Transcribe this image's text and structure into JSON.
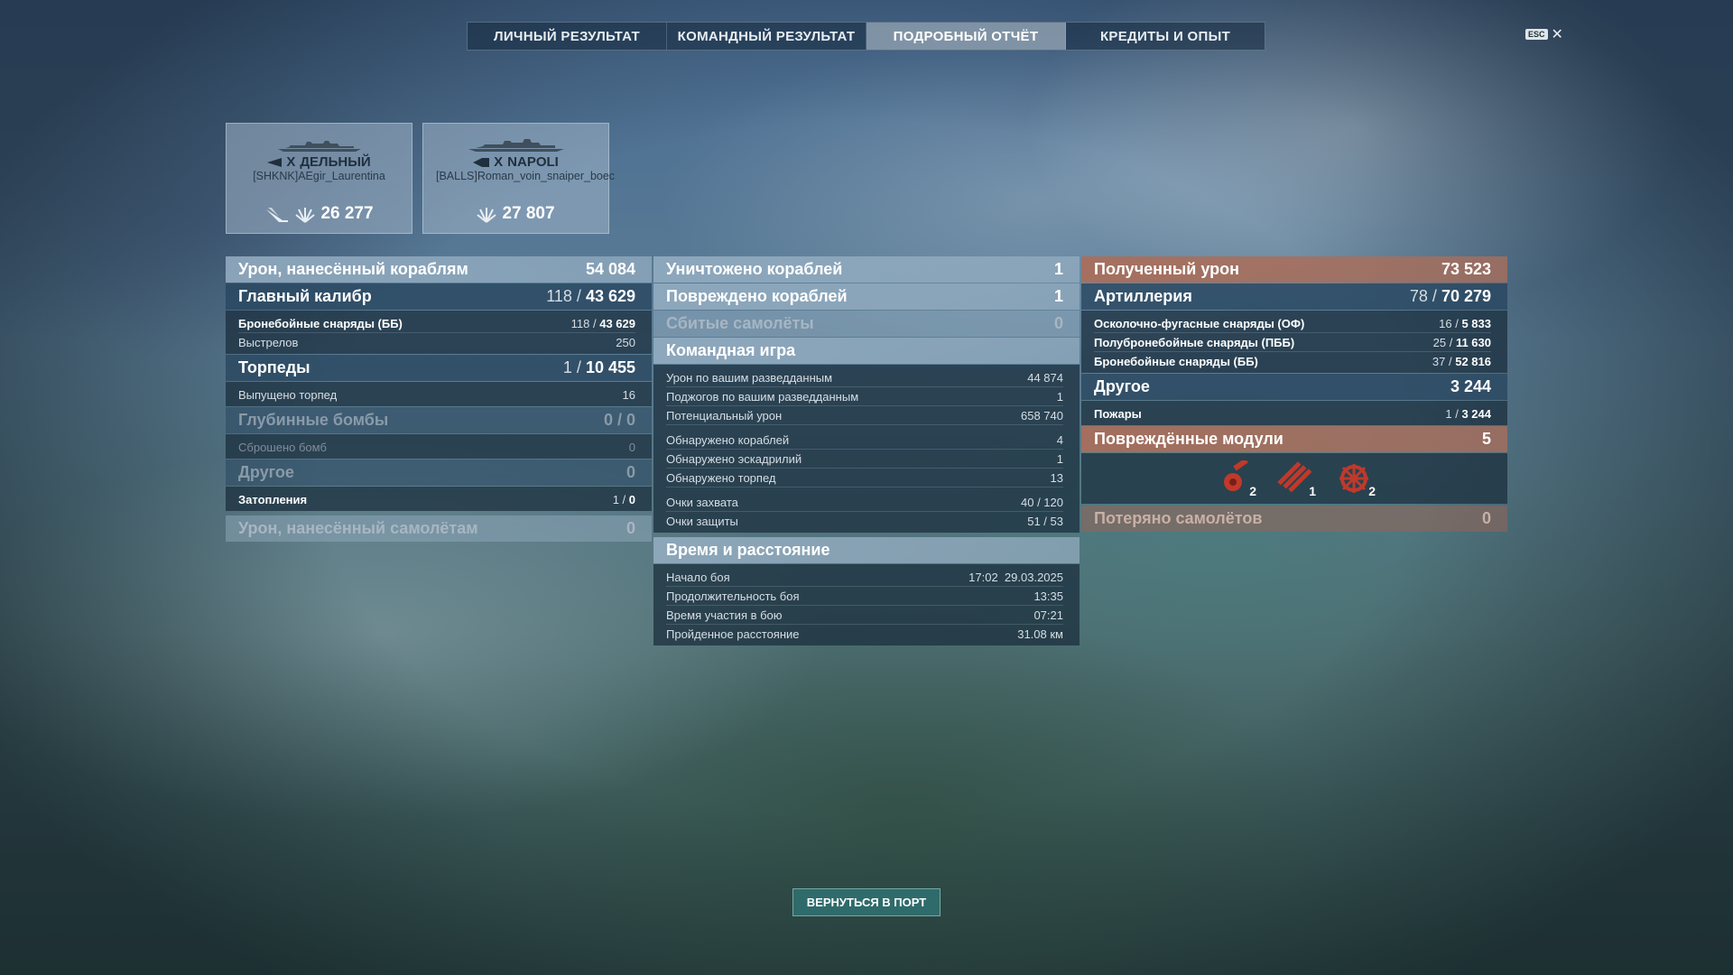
{
  "tabs": [
    {
      "label": "ЛИЧНЫЙ РЕЗУЛЬТАТ",
      "active": false
    },
    {
      "label": "КОМАНДНЫЙ РЕЗУЛЬТАТ",
      "active": false
    },
    {
      "label": "ПОДРОБНЫЙ ОТЧЁТ",
      "active": true
    },
    {
      "label": "КРЕДИТЫ И ОПЫТ",
      "active": false
    }
  ],
  "esc": {
    "key": "ESC",
    "close": "✕"
  },
  "ships": [
    {
      "tier": "X",
      "name": "ДЕЛЬНЫЙ",
      "player": "[SHKNK]AEgir_Laurentina",
      "damage": "26 277"
    },
    {
      "tier": "X",
      "name": "NAPOLI",
      "player": "[BALLS]Roman_voin_snaiper_boec",
      "damage": "27 807"
    }
  ],
  "damage_dealt": {
    "title": "Урон, нанесённый кораблям",
    "value": "54 084",
    "main_battery": {
      "title": "Главный калибр",
      "hits": "118",
      "damage": "43 629"
    },
    "ap_shells": {
      "label": "Бронебойные снаряды (ББ)",
      "hits": "118",
      "damage": "43 629"
    },
    "shots": {
      "label": "Выстрелов",
      "value": "250"
    },
    "torpedoes": {
      "title": "Торпеды",
      "hits": "1",
      "damage": "10 455"
    },
    "torpedoes_launched": {
      "label": "Выпущено торпед",
      "value": "16"
    },
    "depth_charges": {
      "title": "Глубинные бомбы",
      "hits": "0",
      "damage": "0"
    },
    "bombs_dropped": {
      "label": "Сброшено бомб",
      "value": "0"
    },
    "other": {
      "title": "Другое",
      "value": "0"
    },
    "flooding": {
      "label": "Затопления",
      "hits": "1",
      "damage": "0"
    },
    "aircraft_damage": {
      "title": "Урон, нанесённый самолётам",
      "value": "0"
    }
  },
  "results": {
    "destroyed": {
      "title": "Уничтожено кораблей",
      "value": "1"
    },
    "damaged": {
      "title": "Повреждено кораблей",
      "value": "1"
    },
    "planes_shot": {
      "title": "Сбитые самолёты",
      "value": "0"
    },
    "team_play": {
      "title": "Командная игра",
      "rows": [
        {
          "label": "Урон по вашим разведданным",
          "value": "44 874"
        },
        {
          "label": "Поджогов по вашим разведданным",
          "value": "1"
        },
        {
          "label": "Потенциальный урон",
          "value": "658 740"
        }
      ],
      "rows2": [
        {
          "label": "Обнаружено кораблей",
          "value": "4"
        },
        {
          "label": "Обнаружено эскадрилий",
          "value": "1"
        },
        {
          "label": "Обнаружено торпед",
          "value": "13"
        }
      ],
      "rows3": [
        {
          "label": "Очки захвата",
          "value": "40 / 120"
        },
        {
          "label": "Очки защиты",
          "value": "51 / 53"
        }
      ]
    },
    "time": {
      "title": "Время и расстояние",
      "rows": [
        {
          "label": "Начало боя",
          "value": "17:02  29.03.2025"
        },
        {
          "label": "Продолжительность боя",
          "value": "13:35"
        },
        {
          "label": "Время участия в бою",
          "value": "07:21"
        },
        {
          "label": "Пройденное расстояние",
          "value": "31.08 км"
        }
      ]
    }
  },
  "damage_received": {
    "title": "Полученный урон",
    "value": "73 523",
    "artillery": {
      "title": "Артиллерия",
      "hits": "78",
      "damage": "70 279"
    },
    "shells": [
      {
        "label": "Осколочно-фугасные снаряды (ОФ)",
        "hits": "16",
        "damage": "5 833"
      },
      {
        "label": "Полубронебойные снаряды (ПББ)",
        "hits": "25",
        "damage": "11 630"
      },
      {
        "label": "Бронебойные снаряды (ББ)",
        "hits": "37",
        "damage": "52 816"
      }
    ],
    "other": {
      "title": "Другое",
      "value": "3 244"
    },
    "fires": {
      "label": "Пожары",
      "hits": "1",
      "damage": "3 244"
    },
    "modules": {
      "title": "Повреждённые модули",
      "value": "5",
      "items": [
        {
          "icon": "turret-icon",
          "count": "2"
        },
        {
          "icon": "torpedo-tubes-icon",
          "count": "1"
        },
        {
          "icon": "steering-gear-icon",
          "count": "2"
        }
      ]
    },
    "planes_lost": {
      "title": "Потеряно самолётов",
      "value": "0"
    }
  },
  "return_button": "ВЕРНУТЬСЯ В ПОРТ",
  "colors": {
    "accent_orange": "#aa6e5a",
    "accent_blue": "#96afc3",
    "button": "#2f6b6b"
  }
}
